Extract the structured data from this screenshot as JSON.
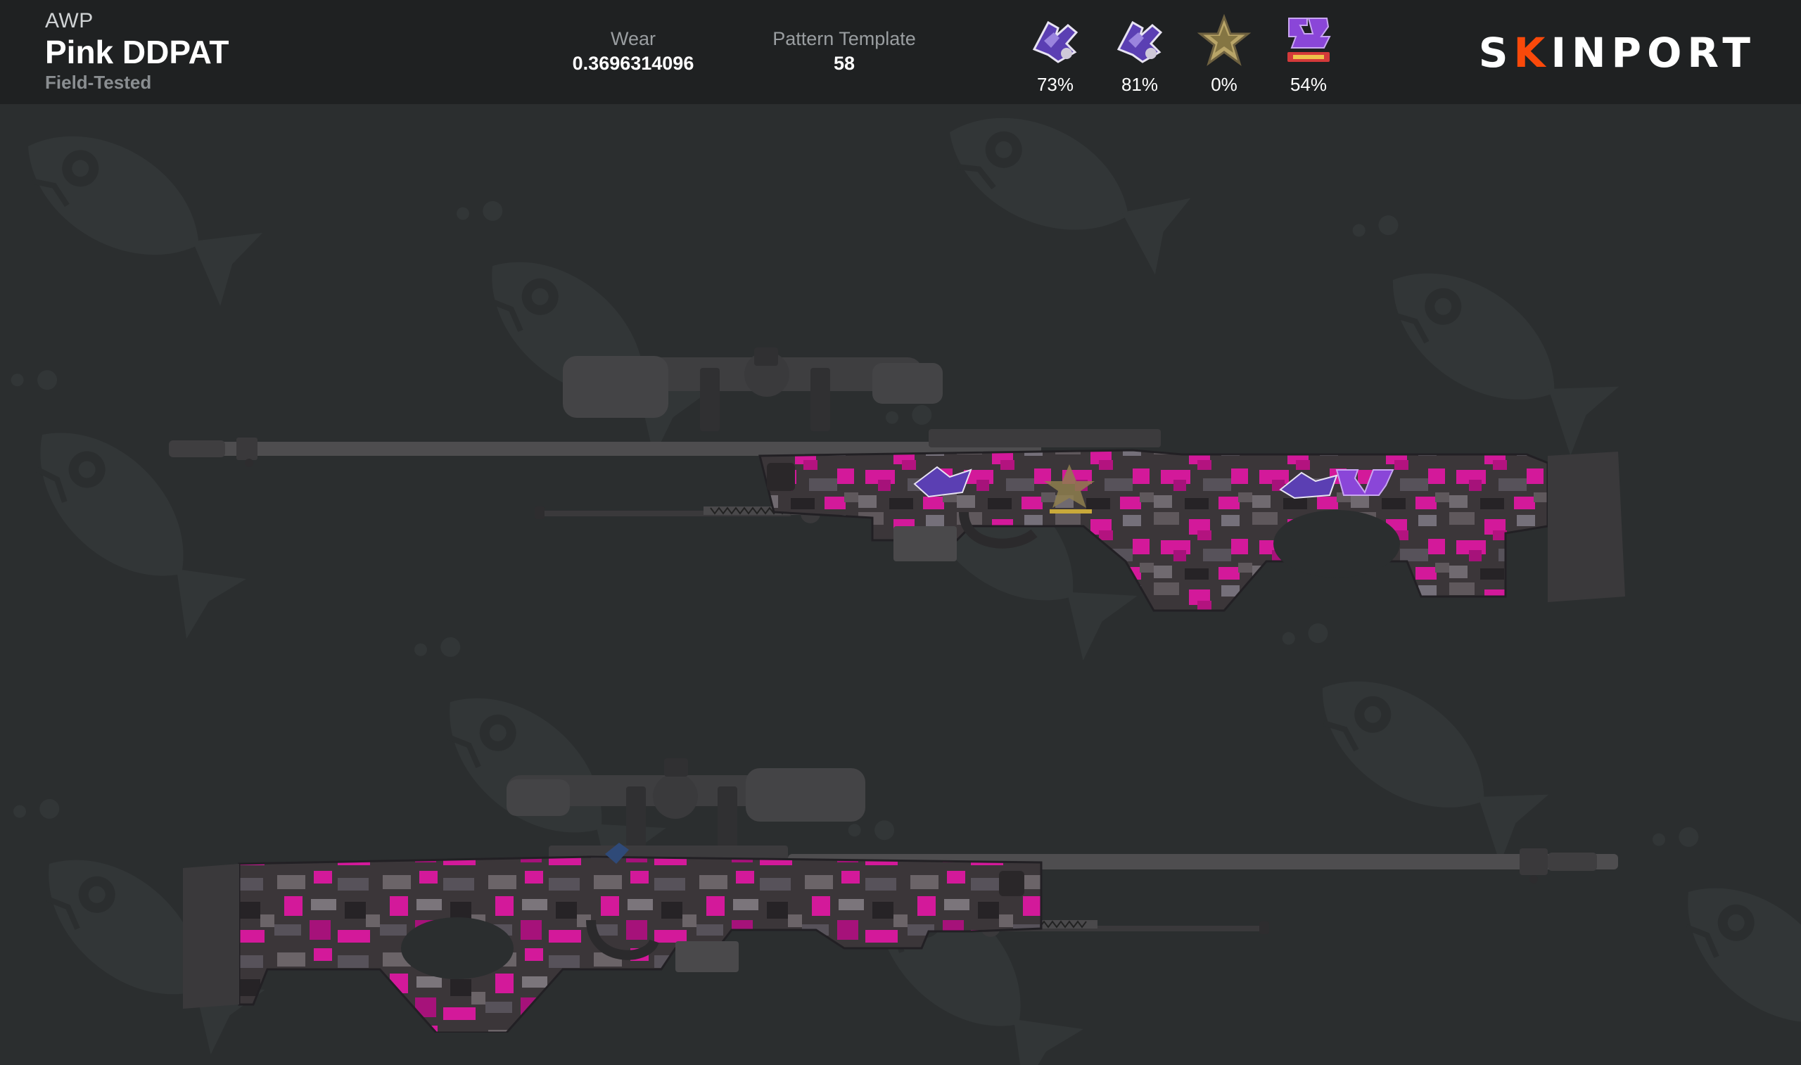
{
  "item": {
    "weapon": "AWP",
    "name": "Pink DDPAT",
    "exterior": "Field-Tested"
  },
  "stats": {
    "wear_label": "Wear",
    "wear_value": "0.3696314096",
    "pattern_label": "Pattern Template",
    "pattern_value": "58"
  },
  "stickers": [
    {
      "icon": "purple-dragon-sticker-icon",
      "wear": "73%"
    },
    {
      "icon": "purple-dragon-sticker-icon",
      "wear": "81%"
    },
    {
      "icon": "gold-star-sticker-icon",
      "wear": "0%"
    },
    {
      "icon": "purple-team-logo-sticker-icon",
      "wear": "54%"
    }
  ],
  "brand": {
    "logo_prefix": "S",
    "logo_accent": "K",
    "logo_suffix": "INPORT",
    "accent_color": "#fa490a"
  },
  "colors": {
    "header_bg": "#1f2122",
    "canvas_bg": "#2b2e2f",
    "camo_pink": "#d3199a",
    "camo_dark": "#3a3639",
    "camo_grey": "#6b6468"
  }
}
